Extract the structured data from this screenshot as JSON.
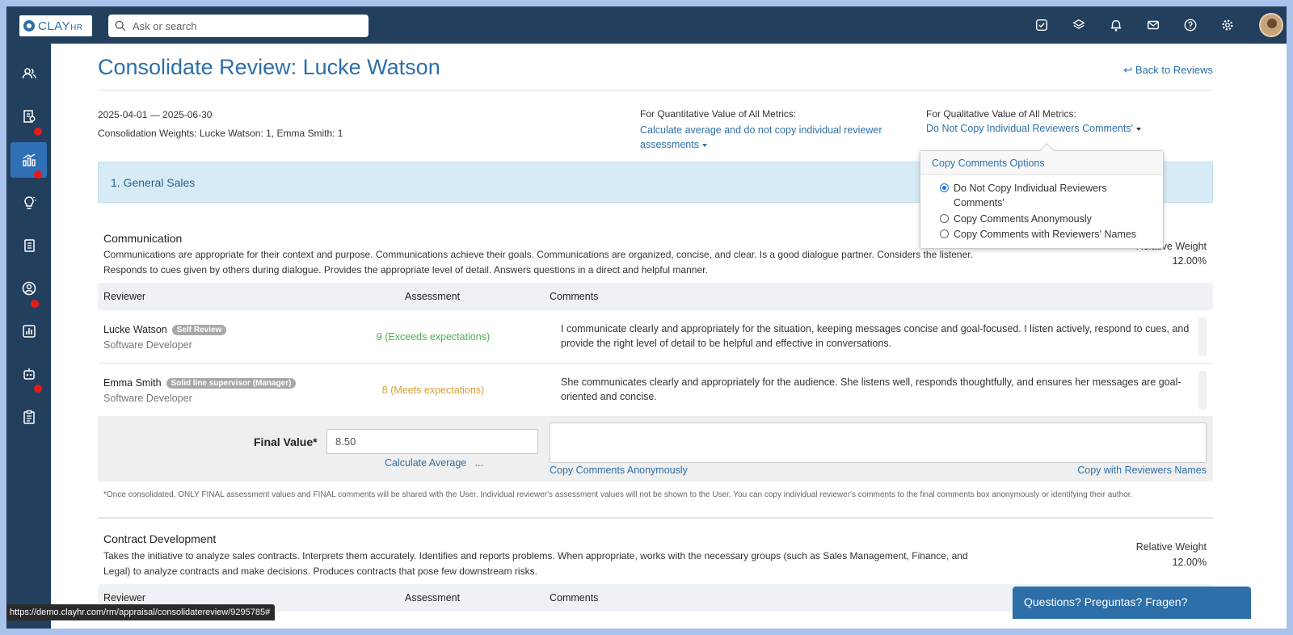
{
  "app": {
    "logo_text": "CLAY",
    "logo_suffix": "HR"
  },
  "search": {
    "placeholder": "Ask or search"
  },
  "header_icons": [
    "inbox-check-icon",
    "layers-icon",
    "bell-icon",
    "mail-icon",
    "help-icon",
    "gear-icon"
  ],
  "sidebar": {
    "items": [
      {
        "icon": "people-icon",
        "badge": false
      },
      {
        "icon": "building-search-icon",
        "badge": true
      },
      {
        "icon": "chart-growth-icon",
        "badge": true,
        "active": true
      },
      {
        "icon": "lightbulb-icon",
        "badge": false
      },
      {
        "icon": "documents-icon",
        "badge": false
      },
      {
        "icon": "user-circle-icon",
        "badge": true
      },
      {
        "icon": "bar-chart-icon",
        "badge": false
      },
      {
        "icon": "robot-icon",
        "badge": true
      },
      {
        "icon": "clipboard-icon",
        "badge": false
      }
    ]
  },
  "page": {
    "title": "Consolidate Review: Lucke Watson",
    "back_link": "Back to Reviews",
    "date_range": "2025-04-01 — 2025-06-30",
    "weights": "Consolidation Weights: Lucke Watson: 1, Emma Smith: 1",
    "quant_label": "For Quantitative Value of All Metrics:",
    "quant_value": "Calculate average and do not copy individual reviewer assessments",
    "qual_label": "For Qualitative Value of All Metrics:",
    "qual_value": "Do Not Copy Individual Reviewers Comments'"
  },
  "section": {
    "title": "1. General Sales"
  },
  "metric1": {
    "title": "Communication",
    "description": "Communications are appropriate for their context and purpose. Communications achieve their goals. Communications are organized, concise, and clear. Is a good dialogue partner. Considers the listener. Responds to cues given by others during dialogue. Provides the appropriate level of detail. Answers questions in a direct and helpful manner.",
    "relative_weight_label": "Relative Weight",
    "relative_weight": "12.00%",
    "headers": {
      "reviewer": "Reviewer",
      "assessment": "Assessment",
      "comments": "Comments"
    },
    "rows": [
      {
        "name": "Lucke Watson",
        "tag": "Self Review",
        "role": "Software Developer",
        "assessment": "9 (Exceeds expectations)",
        "comment": "I communicate clearly and appropriately for the situation, keeping messages concise and goal-focused. I listen actively, respond to cues, and provide the right level of detail to be helpful and effective in conversations."
      },
      {
        "name": "Emma Smith",
        "tag": "Solid line supervisor (Manager)",
        "role": "Software Developer",
        "assessment": "8 (Meets expectations)",
        "comment": "She communicates clearly and appropriately for the audience. She listens well, responds thoughtfully, and ensures her messages are goal-oriented and concise."
      }
    ],
    "final_label": "Final Value*",
    "final_value": "8.50",
    "calc_average": "Calculate Average",
    "calc_more": "...",
    "copy_anon": "Copy Comments Anonymously",
    "copy_names": "Copy with Reviewers Names",
    "footnote": "*Once consolidated, ONLY FINAL assessment values and FINAL comments will be shared with the User. Individual reviewer's assessment values will not be shown to the User. You can copy individual reviewer's comments to the final comments box anonymously or identifying their author."
  },
  "metric2": {
    "title": "Contract Development",
    "description": "Takes the initiative to analyze sales contracts. Interprets them accurately. Identifies and reports problems. When appropriate, works with the necessary groups (such as Sales Management, Finance, and Legal) to analyze contracts and make decisions. Produces contracts that pose few downstream risks.",
    "relative_weight_label": "Relative Weight",
    "relative_weight": "12.00%",
    "headers": {
      "reviewer": "Reviewer",
      "assessment": "Assessment",
      "comments": "Comments"
    }
  },
  "popup": {
    "title": "Copy Comments Options",
    "options": [
      {
        "label": "Do Not Copy Individual Reviewers Comments'",
        "selected": true
      },
      {
        "label": "Copy Comments Anonymously",
        "selected": false
      },
      {
        "label": "Copy Comments with Reviewers' Names",
        "selected": false
      }
    ]
  },
  "status_url": "https://demo.clayhr.com/rm/appraisal/consolidatereview/9295785#",
  "help_widget": "Questions? Preguntas? Fragen?",
  "colors": {
    "topbar": "#233f5e",
    "link": "#2d6fa8",
    "section_bg": "#d6ebf5",
    "badge": "#e81919",
    "exceeds": "#4caf50",
    "meets": "#d8a030"
  }
}
